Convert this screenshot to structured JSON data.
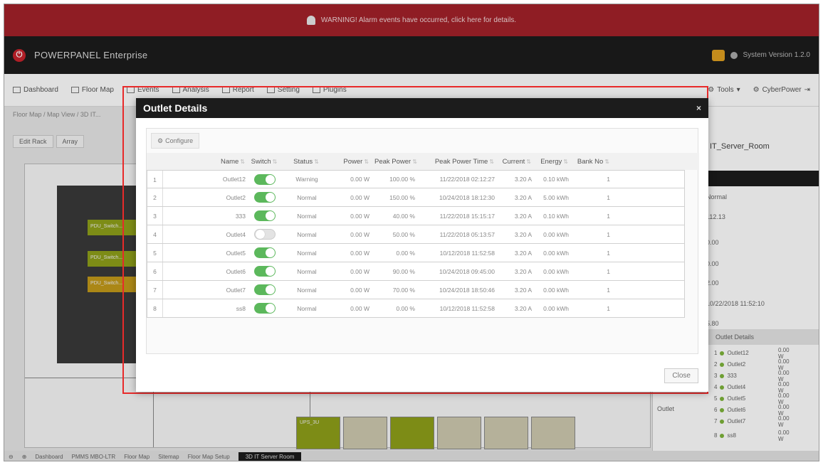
{
  "alert": {
    "text": "WARNING! Alarm events have occurred, click here for details."
  },
  "header": {
    "brand": "POWERPANEL Enterprise",
    "system_version": "System Version 1.2.0"
  },
  "nav": {
    "items": [
      "Dashboard",
      "Floor Map",
      "Events",
      "Analysis",
      "Report",
      "Setting",
      "Plugins"
    ],
    "right": [
      "Tools",
      "CyberPower"
    ]
  },
  "breadcrumb": "Floor Map / Map View / 3D IT...",
  "toolbar": {
    "btn1": "Edit Rack",
    "btn2": "Array"
  },
  "pdu_labels": [
    "PDU_Switch...",
    "PDU_Switch...",
    "PDU_Switch..."
  ],
  "floor_rack_label": "UPS_3U",
  "right_panel": {
    "title": "IT_Server_Room",
    "values": [
      "Normal",
      "112.13",
      "0.00",
      "0.00",
      "2.00",
      "10/22/2018 11:52:10",
      "5.80"
    ],
    "sub_header": "Outlet Details",
    "outlet_label": "Outlet",
    "outlets": [
      {
        "num": "1",
        "name": "Outlet12",
        "value": "0.00 W"
      },
      {
        "num": "2",
        "name": "Outlet2",
        "value": "0.00 W"
      },
      {
        "num": "3",
        "name": "333",
        "value": "0.00 W"
      },
      {
        "num": "4",
        "name": "Outlet4",
        "value": "0.00 W"
      },
      {
        "num": "5",
        "name": "Outlet5",
        "value": "0.00 W"
      },
      {
        "num": "6",
        "name": "Outlet6",
        "value": "0.00 W"
      },
      {
        "num": "7",
        "name": "Outlet7",
        "value": "0.00 W"
      },
      {
        "num": "8",
        "name": "ss8",
        "value": "0.00 W"
      }
    ]
  },
  "bottom_tabs": [
    "Dashboard",
    "PMMS MBO-LTR",
    "Floor Map",
    "Sitemap",
    "Floor Map Setup",
    "3D IT Server Room"
  ],
  "modal": {
    "title": "Outlet Details",
    "close": "×",
    "configure": "Configure",
    "close_button": "Close",
    "columns": [
      "Name",
      "Switch",
      "Status",
      "Power",
      "Peak Power",
      "Peak Power Time",
      "Current",
      "Energy",
      "Bank No"
    ],
    "rows": [
      {
        "idx": "1",
        "name": "Outlet12",
        "switch": "on",
        "status": "Warning",
        "power": "0.00 W",
        "peak_power": "100.00 %",
        "peak_time": "11/22/2018 02:12:27",
        "current": "3.20 A",
        "energy": "0.10 kWh",
        "bank": "1"
      },
      {
        "idx": "2",
        "name": "Outlet2",
        "switch": "on",
        "status": "Normal",
        "power": "0.00 W",
        "peak_power": "150.00 %",
        "peak_time": "10/24/2018 18:12:30",
        "current": "3.20 A",
        "energy": "5.00 kWh",
        "bank": "1"
      },
      {
        "idx": "3",
        "name": "333",
        "switch": "on",
        "status": "Normal",
        "power": "0.00 W",
        "peak_power": "40.00 %",
        "peak_time": "11/22/2018 15:15:17",
        "current": "3.20 A",
        "energy": "0.10 kWh",
        "bank": "1"
      },
      {
        "idx": "4",
        "name": "Outlet4",
        "switch": "off",
        "status": "Normal",
        "power": "0.00 W",
        "peak_power": "50.00 %",
        "peak_time": "11/22/2018 05:13:57",
        "current": "3.20 A",
        "energy": "0.00 kWh",
        "bank": "1"
      },
      {
        "idx": "5",
        "name": "Outlet5",
        "switch": "on",
        "status": "Normal",
        "power": "0.00 W",
        "peak_power": "0.00 %",
        "peak_time": "10/12/2018 11:52:58",
        "current": "3.20 A",
        "energy": "0.00 kWh",
        "bank": "1"
      },
      {
        "idx": "6",
        "name": "Outlet6",
        "switch": "on",
        "status": "Normal",
        "power": "0.00 W",
        "peak_power": "90.00 %",
        "peak_time": "10/24/2018 09:45:00",
        "current": "3.20 A",
        "energy": "0.00 kWh",
        "bank": "1"
      },
      {
        "idx": "7",
        "name": "Outlet7",
        "switch": "on",
        "status": "Normal",
        "power": "0.00 W",
        "peak_power": "70.00 %",
        "peak_time": "10/24/2018 18:50:46",
        "current": "3.20 A",
        "energy": "0.00 kWh",
        "bank": "1"
      },
      {
        "idx": "8",
        "name": "ss8",
        "switch": "on",
        "status": "Normal",
        "power": "0.00 W",
        "peak_power": "0.00 %",
        "peak_time": "10/12/2018 11:52:58",
        "current": "3.20 A",
        "energy": "0.00 kWh",
        "bank": "1"
      }
    ]
  },
  "colors": {
    "alert_bg": "#a3212a",
    "header_bg": "#1c1c1c",
    "toggle_on": "#5cb85c",
    "highlight": "#e82a2a"
  }
}
